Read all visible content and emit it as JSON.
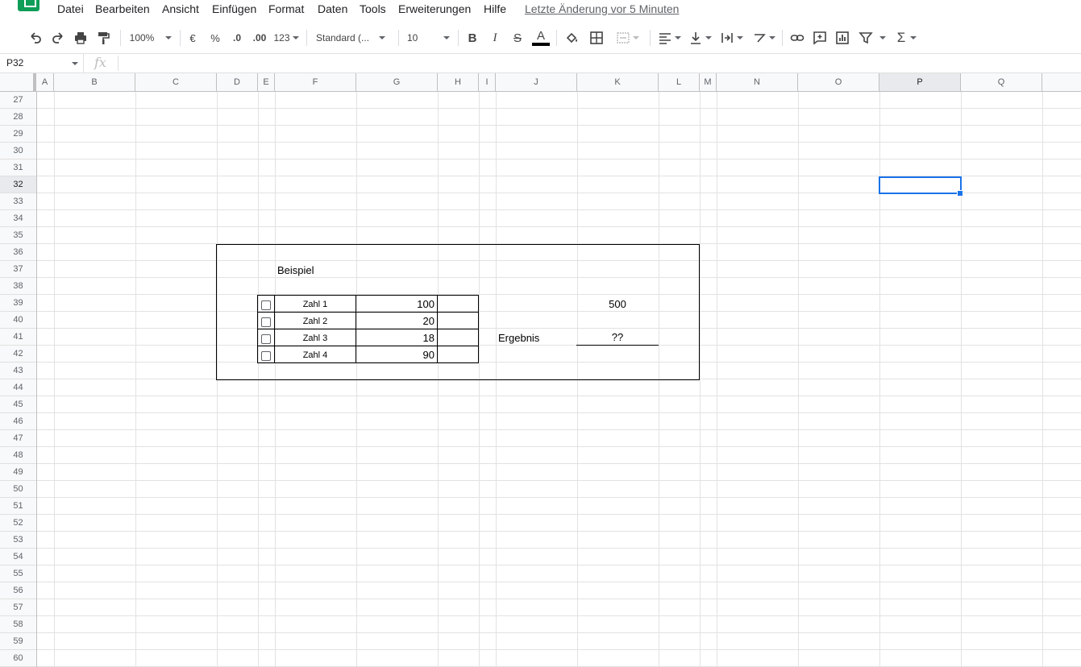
{
  "menubar": {
    "items": [
      "Datei",
      "Bearbeiten",
      "Ansicht",
      "Einfügen",
      "Format",
      "Daten",
      "Tools",
      "Erweiterungen",
      "Hilfe"
    ],
    "last_edit": "Letzte Änderung vor 5 Minuten"
  },
  "toolbar": {
    "zoom": "100%",
    "currency": "€",
    "percent": "%",
    "dec_decrease": ".0",
    "dec_increase": ".00",
    "more_formats": "123",
    "font": "Standard (...",
    "font_size": "10",
    "bold": "B",
    "italic": "I",
    "strike": "S",
    "text_color": "A",
    "text_color_value": "#000000",
    "sum": "Σ"
  },
  "formula_bar": {
    "cell_ref": "P32",
    "fx": "fx",
    "content": ""
  },
  "grid": {
    "columns": [
      "A",
      "B",
      "C",
      "D",
      "E",
      "F",
      "G",
      "H",
      "I",
      "J",
      "K",
      "L",
      "M",
      "N",
      "O",
      "P",
      "Q"
    ],
    "rows": [
      "27",
      "28",
      "29",
      "30",
      "31",
      "32",
      "33",
      "34",
      "35",
      "36",
      "37",
      "38",
      "39",
      "40",
      "41",
      "42",
      "43",
      "44",
      "45",
      "46",
      "47",
      "48",
      "49",
      "50",
      "51",
      "52",
      "53",
      "54",
      "55",
      "56",
      "57",
      "58",
      "59",
      "60"
    ],
    "selected_cell": "P32"
  },
  "sheet": {
    "title": "Beispiel",
    "table": [
      {
        "label": "Zahl 1",
        "value": "100"
      },
      {
        "label": "Zahl 2",
        "value": "20"
      },
      {
        "label": "Zahl 3",
        "value": "18"
      },
      {
        "label": "Zahl 4",
        "value": "90"
      }
    ],
    "target": "500",
    "result_label": "Ergebnis",
    "result_value": "??"
  },
  "colors": {
    "accent": "#1a73e8",
    "brand": "#0f9d58"
  }
}
